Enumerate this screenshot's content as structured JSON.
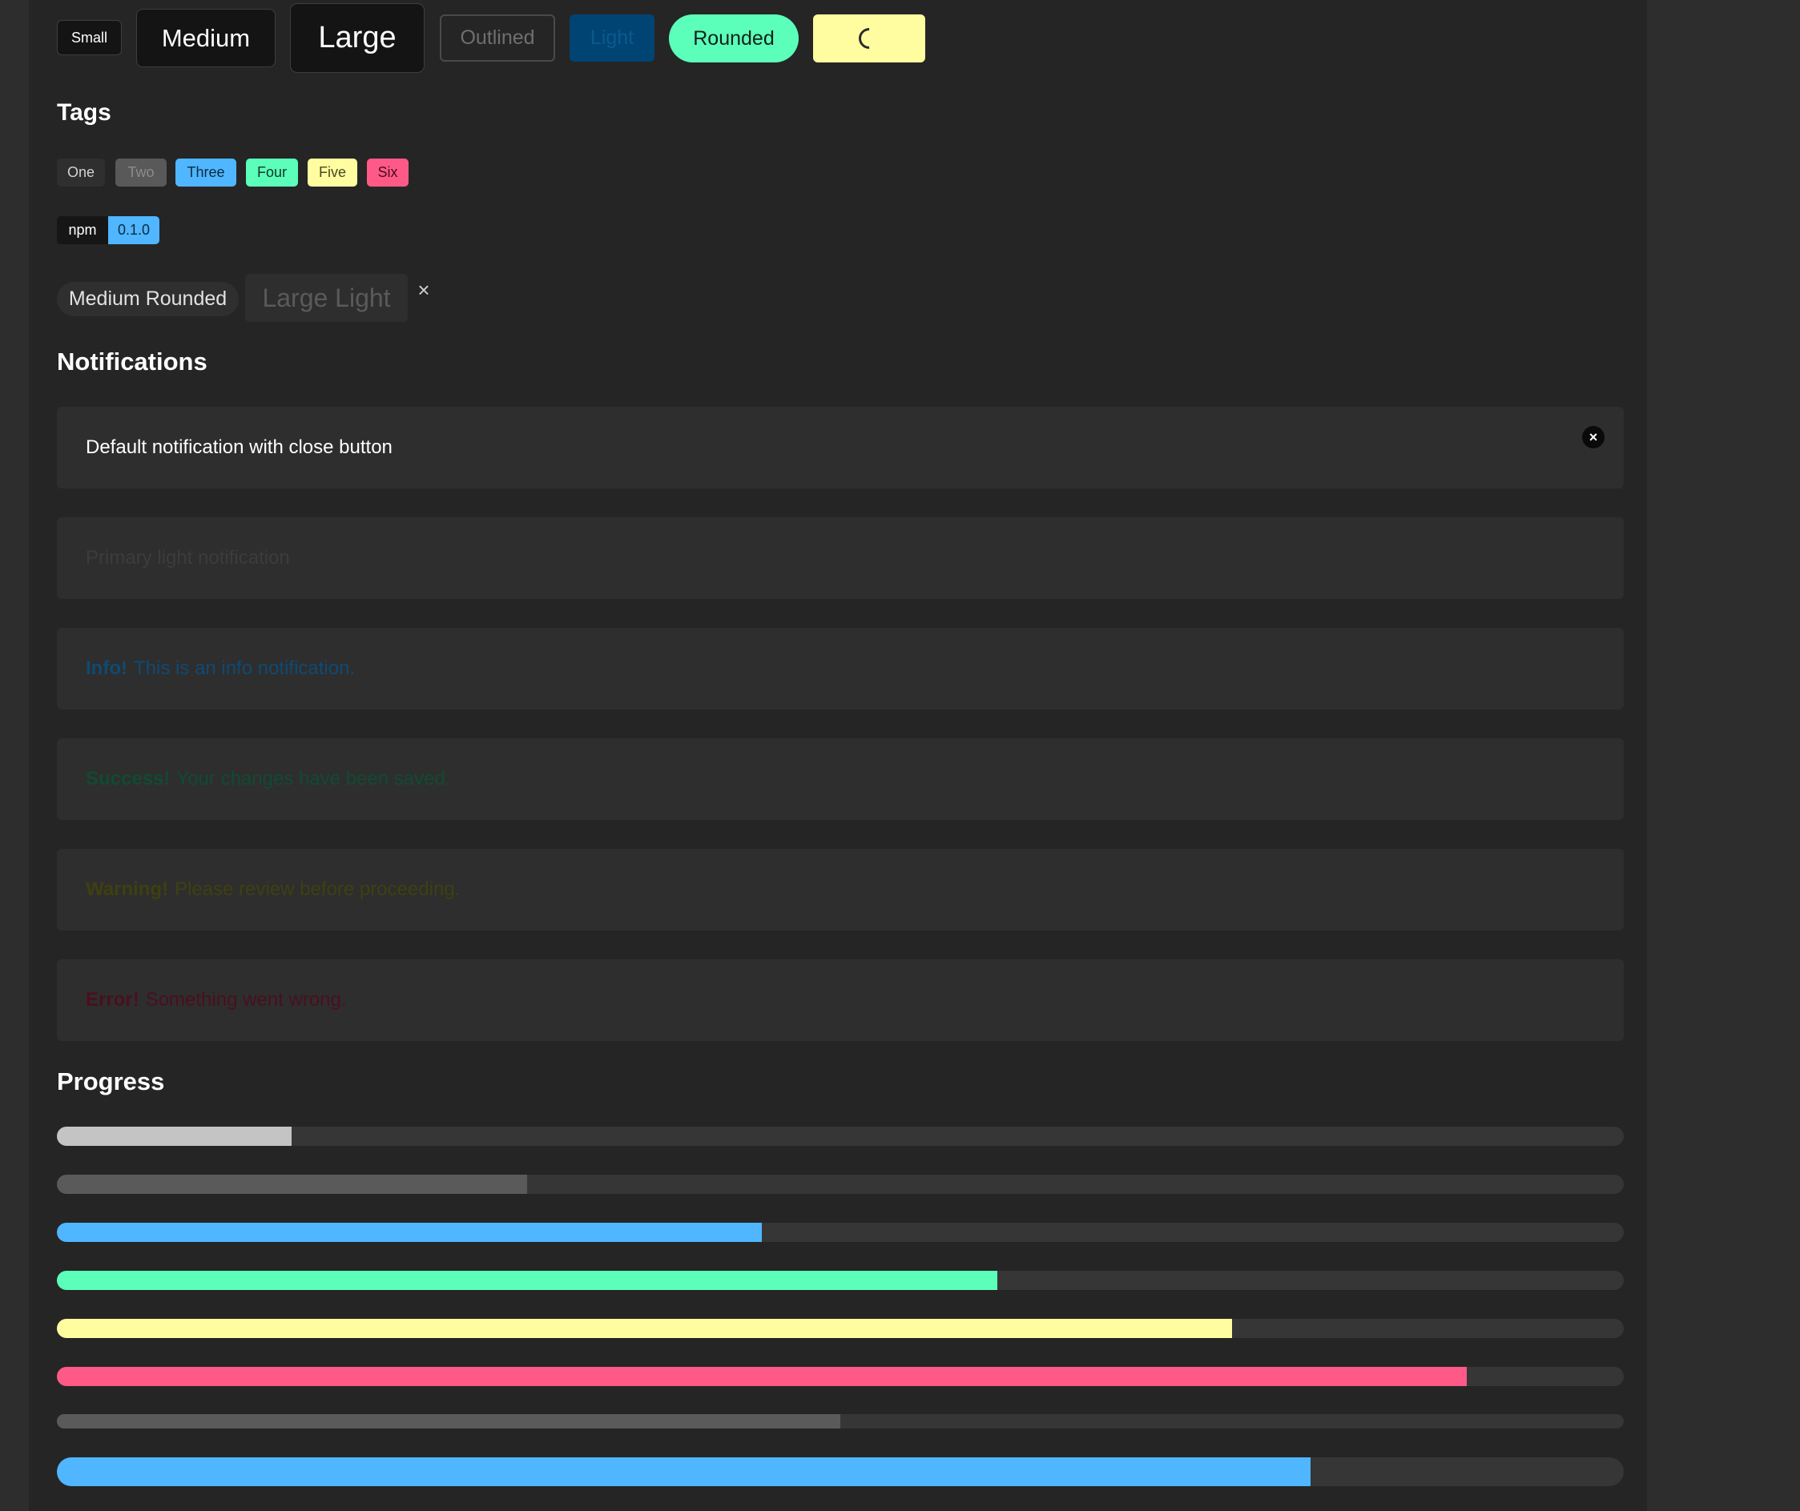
{
  "buttons": {
    "small": "Small",
    "medium": "Medium",
    "large": "Large",
    "outlined": "Outlined",
    "light": "Light",
    "rounded": "Rounded",
    "loading_icon": "spinner-icon"
  },
  "tags": {
    "heading": "Tags",
    "items": [
      "One",
      "Two",
      "Three",
      "Four",
      "Five",
      "Six"
    ],
    "addon": {
      "label": "npm",
      "value": "0.1.0"
    },
    "medium_rounded": "Medium Rounded",
    "large_light": "Large Light",
    "delete_glyph": "×"
  },
  "notifications": {
    "heading": "Notifications",
    "default": "Default notification with close button",
    "close_glyph": "×",
    "primary_light": "Primary light notification",
    "info": {
      "strong": "Info!",
      "text": "This is an info notification."
    },
    "success": {
      "strong": "Success!",
      "text": "Your changes have been saved."
    },
    "warning": {
      "strong": "Warning!",
      "text": "Please review before proceeding."
    },
    "error": {
      "strong": "Error!",
      "text": "Something went wrong."
    }
  },
  "progress": {
    "heading": "Progress",
    "bars": [
      {
        "value": 15,
        "max": 100,
        "color": "#c4c4c4"
      },
      {
        "value": 30,
        "max": 100,
        "color": "#5a5a5a"
      },
      {
        "value": 45,
        "max": 100,
        "color": "#4fb6ff"
      },
      {
        "value": 60,
        "max": 100,
        "color": "#5cffb9"
      },
      {
        "value": 75,
        "max": 100,
        "color": "#fffda0"
      },
      {
        "value": 90,
        "max": 100,
        "color": "#ff5a87"
      },
      {
        "value": 50,
        "max": 100,
        "color": "#5a5a5a"
      },
      {
        "value": 80,
        "max": 100,
        "color": "#4fb6ff"
      }
    ]
  },
  "colors": {
    "primary": "#4fb6ff",
    "success": "#5cffb9",
    "warning": "#fffda0",
    "danger": "#ff5a87",
    "background": "#252525"
  }
}
